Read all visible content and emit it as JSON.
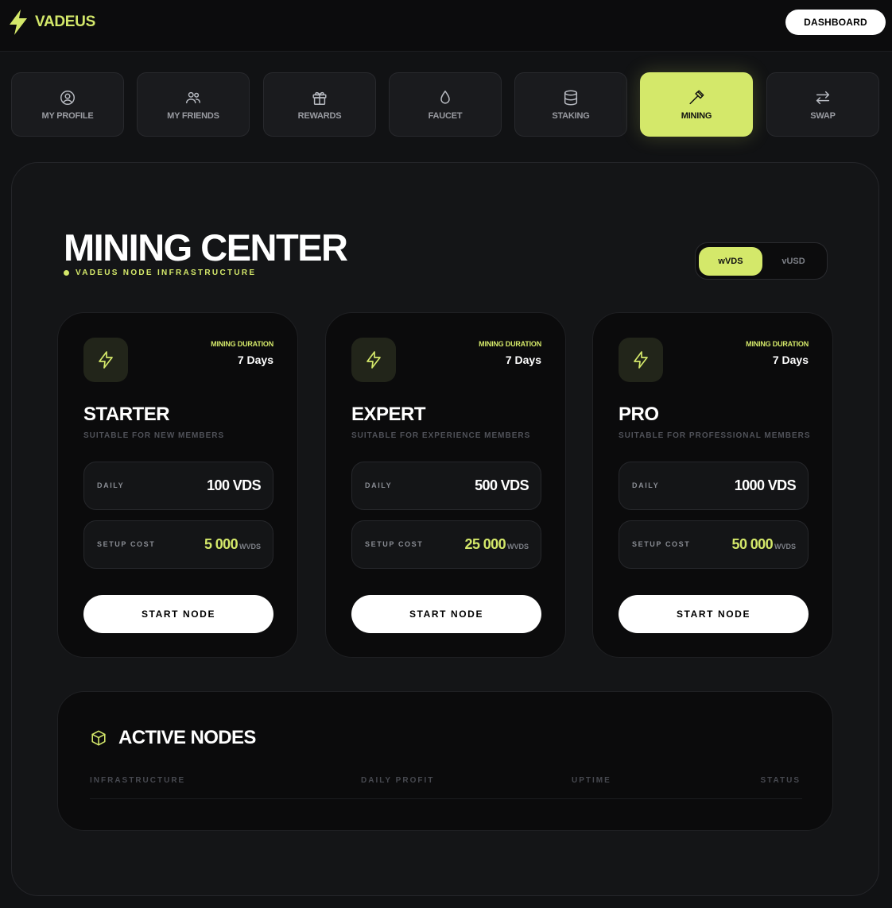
{
  "header": {
    "brand_name": "VADEUS",
    "dashboard_label": "DASHBOARD"
  },
  "nav": {
    "tabs": [
      {
        "label": "MY PROFILE",
        "icon": "user-circle-icon",
        "active": false
      },
      {
        "label": "MY FRIENDS",
        "icon": "users-icon",
        "active": false
      },
      {
        "label": "REWARDS",
        "icon": "gift-icon",
        "active": false
      },
      {
        "label": "FAUCET",
        "icon": "droplet-icon",
        "active": false
      },
      {
        "label": "STAKING",
        "icon": "database-icon",
        "active": false
      },
      {
        "label": "MINING",
        "icon": "hammer-icon",
        "active": true
      },
      {
        "label": "SWAP",
        "icon": "swap-arrows-icon",
        "active": false
      }
    ]
  },
  "main": {
    "title": "MINING CENTER",
    "subtitle": "VADEUS NODE INFRASTRUCTURE",
    "currency_toggle": {
      "options": [
        "wVDS",
        "vUSD"
      ],
      "selected": "wVDS"
    }
  },
  "plans": [
    {
      "icon": "lightning-icon",
      "duration_label": "MINING DURATION",
      "duration_value": "7 Days",
      "name": "STARTER",
      "description": "SUITABLE FOR NEW MEMBERS",
      "daily_label": "DAILY",
      "daily_value": "100 VDS",
      "cost_label": "SETUP COST",
      "cost_value": "5 000",
      "cost_unit": "WVDS",
      "button_label": "START NODE"
    },
    {
      "icon": "lightning-icon",
      "duration_label": "MINING DURATION",
      "duration_value": "7 Days",
      "name": "EXPERT",
      "description": "SUITABLE FOR EXPERIENCE MEMBERS",
      "daily_label": "DAILY",
      "daily_value": "500 VDS",
      "cost_label": "SETUP COST",
      "cost_value": "25 000",
      "cost_unit": "WVDS",
      "button_label": "START NODE"
    },
    {
      "icon": "lightning-icon",
      "duration_label": "MINING DURATION",
      "duration_value": "7 Days",
      "name": "PRO",
      "description": "SUITABLE FOR PROFESSIONAL MEMBERS",
      "daily_label": "DAILY",
      "daily_value": "1000 VDS",
      "cost_label": "SETUP COST",
      "cost_value": "50 000",
      "cost_unit": "WVDS",
      "button_label": "START NODE"
    }
  ],
  "active_nodes": {
    "icon": "cube-icon",
    "title": "ACTIVE NODES",
    "columns": [
      "INFRASTRUCTURE",
      "DAILY PROFIT",
      "UPTIME",
      "STATUS"
    ],
    "rows": []
  },
  "colors": {
    "accent": "#d4e86a",
    "background": "#111214",
    "card": "#0b0b0c"
  }
}
